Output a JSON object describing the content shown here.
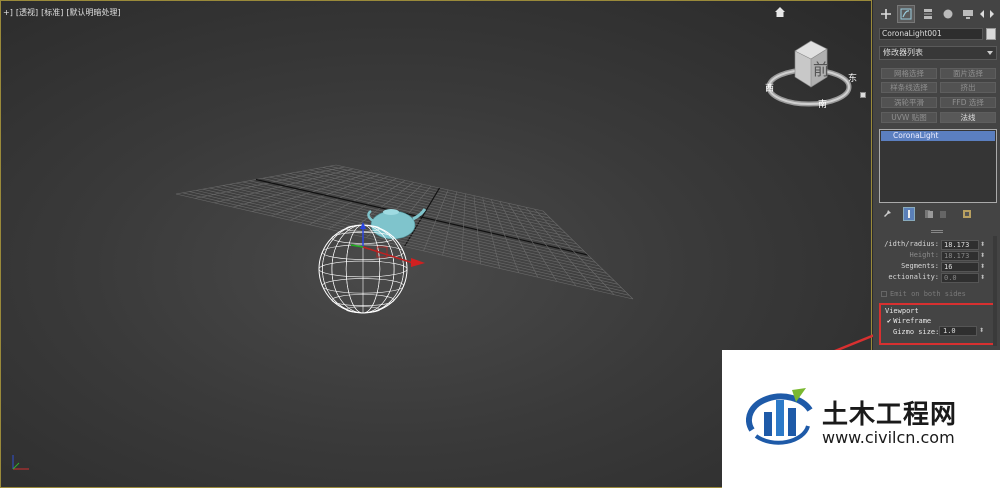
{
  "viewport": {
    "labels": [
      "+]",
      "[透视]",
      "[标准]",
      "[默认明暗处理]"
    ],
    "viewcube_face": "前",
    "viewcube_compass": [
      "南",
      "西",
      "东"
    ]
  },
  "panel": {
    "object_name": "CoronaLight001",
    "modifier_list": "修改器列表",
    "modifier_buttons": [
      {
        "label": "网格选择",
        "active": false
      },
      {
        "label": "面片选择",
        "active": false
      },
      {
        "label": "样条线选择",
        "active": false
      },
      {
        "label": "挤出",
        "active": false
      },
      {
        "label": "涡轮平滑",
        "active": false
      },
      {
        "label": "FFD 选择",
        "active": false
      },
      {
        "label": "UVW 贴图",
        "active": false
      },
      {
        "label": "法线",
        "active": true
      }
    ],
    "stack_item": "CoronaLight",
    "params": [
      {
        "label": "/idth/radius:",
        "value": "18.173",
        "dim": false
      },
      {
        "label": "Height:",
        "value": "18.173",
        "dim": true
      },
      {
        "label": "Segments:",
        "value": "16",
        "dim": false
      },
      {
        "label": "ectionality:",
        "value": "0.0",
        "dim": true
      }
    ],
    "emit_both_sides": "Emit on both sides",
    "viewport_group": {
      "title": "Viewport",
      "wireframe_label": "Wireframe",
      "wireframe_checked": true,
      "gizmo_label": "Gizmo size:",
      "gizmo_value": "1.0"
    }
  },
  "watermark": {
    "name_cn": "土木工程网",
    "url": "www.civilcn.com"
  },
  "colors": {
    "annotation_red": "#d83030",
    "selection_blue": "#5b7fc0",
    "wireframe_white": "#ffffff",
    "teapot_cyan": "#7fc4cc"
  }
}
